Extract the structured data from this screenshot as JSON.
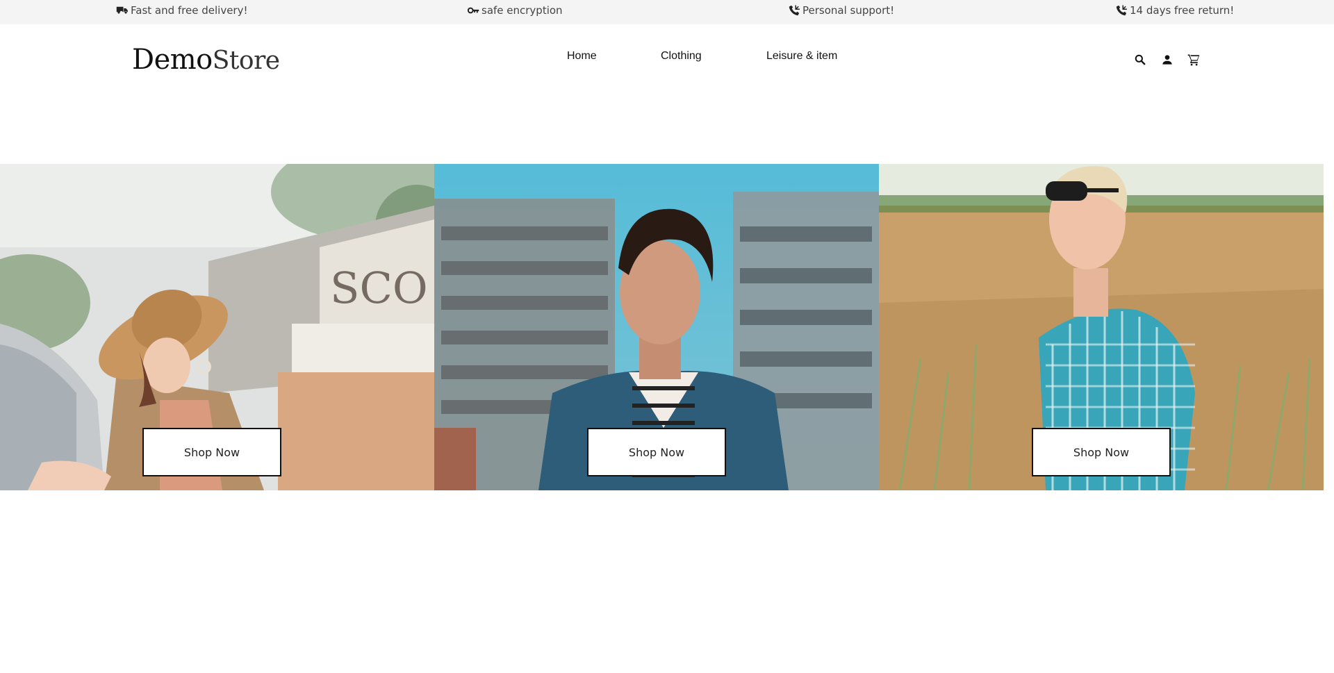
{
  "topbar": {
    "items": [
      {
        "label": "Fast and free delivery!",
        "icon": "truck-icon"
      },
      {
        "label": "safe encryption",
        "icon": "key-icon"
      },
      {
        "label": "Personal support!",
        "icon": "phone-icon"
      },
      {
        "label": "14 days free return!",
        "icon": "phone-icon"
      }
    ]
  },
  "header": {
    "logo": {
      "part1": "Demo",
      "part2": "Store"
    },
    "nav": [
      {
        "label": "Home"
      },
      {
        "label": "Clothing"
      },
      {
        "label": "Leisure & item"
      }
    ],
    "icons": [
      "search-icon",
      "user-icon",
      "cart-icon"
    ]
  },
  "hero": {
    "panels": [
      {
        "button_label": "Shop Now",
        "subject": "woman in straw hat"
      },
      {
        "button_label": "Shop Now",
        "subject": "man in denim shirt"
      },
      {
        "button_label": "Shop Now",
        "subject": "boy in wheat field"
      }
    ]
  },
  "colors": {
    "topbar_bg": "#f4f4f4",
    "text": "#111111",
    "button_border": "#111111"
  }
}
